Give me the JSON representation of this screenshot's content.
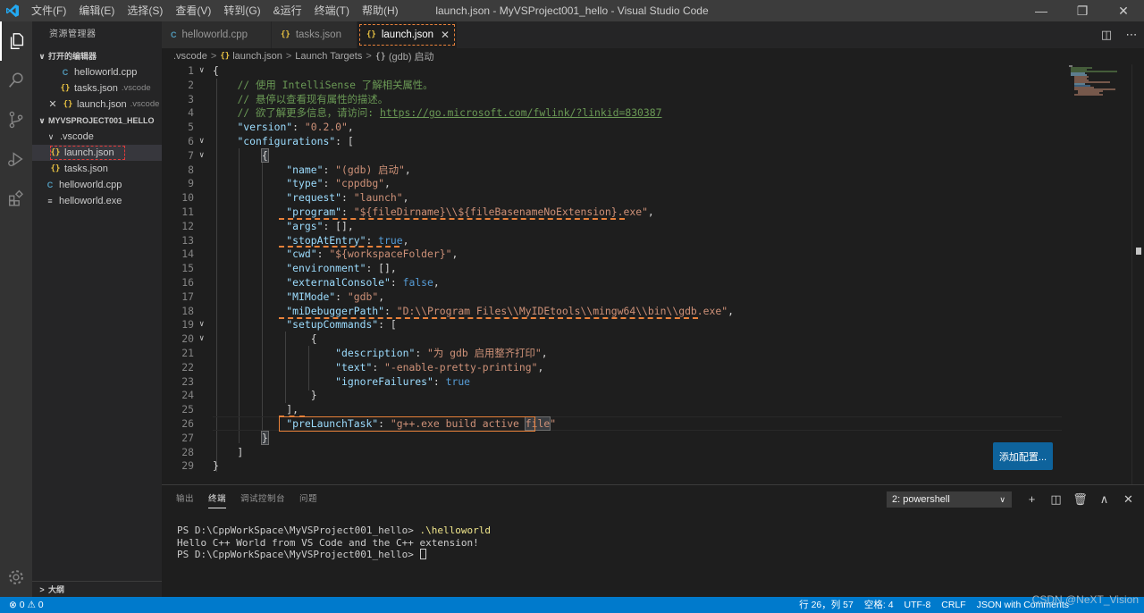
{
  "window": {
    "title": "launch.json - MyVSProject001_hello - Visual Studio Code"
  },
  "menu": [
    "文件(F)",
    "编辑(E)",
    "选择(S)",
    "查看(V)",
    "转到(G)",
    "&运行",
    "终端(T)",
    "帮助(H)"
  ],
  "sidebar": {
    "header": "资源管理器",
    "open_editors": {
      "title": "打开的编辑器",
      "items": [
        {
          "name": "helloworld.cpp",
          "desc": ""
        },
        {
          "name": "tasks.json",
          "desc": ".vscode"
        },
        {
          "name": "launch.json",
          "desc": ".vscode"
        }
      ]
    },
    "project": {
      "title": "MYVSPROJECT001_HELLO",
      "folder": ".vscode",
      "folder_items": [
        "launch.json",
        "tasks.json"
      ],
      "root_items": [
        "helloworld.cpp",
        "helloworld.exe"
      ]
    },
    "outline_title": "大纲"
  },
  "tabs": [
    {
      "label": "helloworld.cpp"
    },
    {
      "label": "tasks.json"
    },
    {
      "label": "launch.json"
    }
  ],
  "breadcrumb": [
    ".vscode",
    "launch.json",
    "Launch Targets",
    "(gdb) 启动"
  ],
  "editor": {
    "add_config_label": "添加配置..."
  },
  "panel": {
    "tabs": [
      "输出",
      "终端",
      "调试控制台",
      "问题"
    ],
    "terminal_select": "2: powershell",
    "terminal_lines": [
      {
        "prompt": "PS D:\\CppWorkSpace\\MyVSProject001_hello> ",
        "cmd": ".\\helloworld"
      },
      {
        "prompt": "Hello C++ World from VS Code and the C++ extension!",
        "cmd": ""
      },
      {
        "prompt": "PS D:\\CppWorkSpace\\MyVSProject001_hello> ",
        "cmd": ""
      }
    ]
  },
  "statusbar": {
    "problems": "⊗ 0 ⚠ 0",
    "position": "行 26，列 57",
    "spaces": "空格: 4",
    "encoding": "UTF-8",
    "eol": "CRLF",
    "language": "JSON with Comments"
  },
  "watermark": "CSDN @NeXT_Vision",
  "colors": {
    "accent": "#007acc",
    "annotation": "#e8813a",
    "highlight_box": "#e03b3b"
  }
}
